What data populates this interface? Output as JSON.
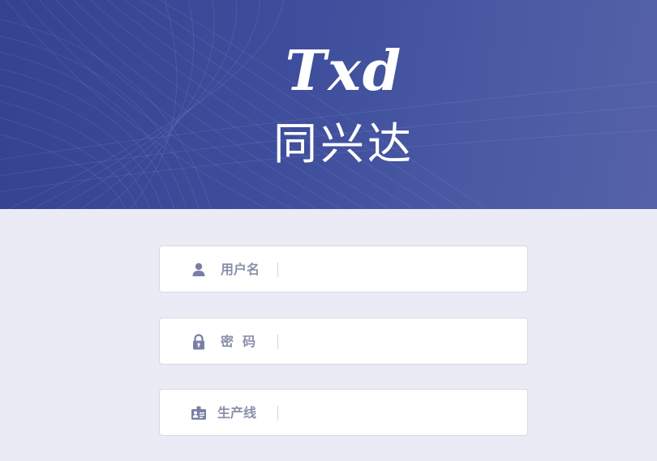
{
  "header": {
    "logo_text": "Txd",
    "brand_name": "同兴达"
  },
  "form": {
    "username": {
      "label": "用户名",
      "value": "",
      "placeholder": "",
      "icon": "user-icon"
    },
    "password": {
      "label": "密  码",
      "value": "",
      "placeholder": "",
      "icon": "lock-icon"
    },
    "production_line": {
      "label": "生产线",
      "value": "",
      "placeholder": "",
      "icon": "id-card-icon"
    }
  },
  "colors": {
    "header_start": "#34428f",
    "header_end": "#5562a8",
    "page_bg": "#ebebf5",
    "label": "#8b8fab",
    "icon": "#7b7fa6"
  }
}
